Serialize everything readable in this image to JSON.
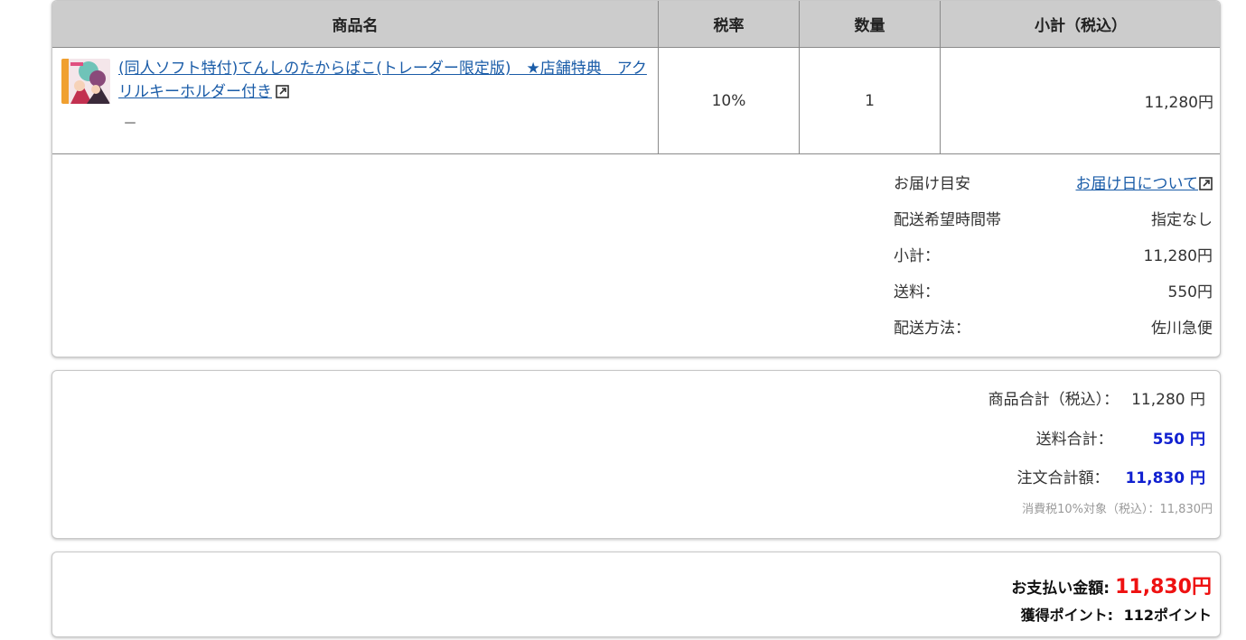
{
  "table": {
    "headers": [
      "商品名",
      "税率",
      "数量",
      "小計（税込）"
    ],
    "item": {
      "title": "(同人ソフト特付)てんしのたからばこ(トレーダー限定版)　★店舗特典　アクリルキーホルダー付き",
      "sub": "－",
      "tax_rate": "10%",
      "quantity": "1",
      "subtotal": "11,280円",
      "thumbnail_icon": "product-thumbnail-image",
      "link_icon": "external-link-icon"
    }
  },
  "delivery": {
    "estimate_label": "お届け目安",
    "estimate_link": "お届け日について",
    "time_label": "配送希望時間帯",
    "time_value": "指定なし",
    "subtotal_label": "小計：",
    "subtotal_value": "11,280円",
    "shipping_label": "送料：",
    "shipping_value": "550円",
    "method_label": "配送方法：",
    "method_value": "佐川急便"
  },
  "totals": {
    "goods_label": "商品合計（税込）：",
    "goods_value": "11,280 円",
    "shipping_label": "送料合計：",
    "shipping_value": "550 円",
    "order_label": "注文合計額：",
    "order_value": "11,830 円",
    "tax_note": "消費税10%対象（税込）：11,830円"
  },
  "payment": {
    "label": "お支払い金額:",
    "value": "11,830円",
    "points_label": "獲得ポイント:",
    "points_value": "112ポイント"
  },
  "colors": {
    "link": "#1a5ca8",
    "emphasis_blue": "#1020d0",
    "pay_red": "#ee1111",
    "header_bg": "#cccccc"
  }
}
